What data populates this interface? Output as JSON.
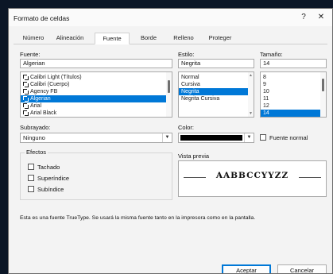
{
  "dialog": {
    "title": "Formato de celdas",
    "help": "?",
    "close": "✕"
  },
  "tabs": [
    {
      "label": "Número"
    },
    {
      "label": "Alineación"
    },
    {
      "label": "Fuente"
    },
    {
      "label": "Borde"
    },
    {
      "label": "Relleno"
    },
    {
      "label": "Proteger"
    }
  ],
  "fuente": {
    "label": "Fuente:",
    "value": "Algerian",
    "list": [
      {
        "name": "Calibri Light (Títulos)"
      },
      {
        "name": "Calibri (Cuerpo)"
      },
      {
        "name": "Agency FB"
      },
      {
        "name": "Algerian"
      },
      {
        "name": "Arial"
      },
      {
        "name": "Arial Black"
      }
    ]
  },
  "estilo": {
    "label": "Estilo:",
    "value": "Negrita",
    "list": [
      "Normal",
      "Cursiva",
      "Negrita",
      "Negrita Cursiva"
    ]
  },
  "tamano": {
    "label": "Tamaño:",
    "value": "14",
    "list": [
      "8",
      "9",
      "10",
      "11",
      "12",
      "14"
    ]
  },
  "subrayado": {
    "label": "Subrayado:",
    "value": "Ninguno"
  },
  "color": {
    "label": "Color:",
    "swatch": "#000000",
    "normal_label": "Fuente normal"
  },
  "efectos": {
    "label": "Efectos",
    "tachado": "Tachado",
    "superindice": "Superíndice",
    "subindice": "Subíndice"
  },
  "vista": {
    "label": "Vista previa",
    "text": "AABBCCYYZZ"
  },
  "info": "Esta es una fuente TrueType. Se usará la misma fuente tanto en la impresora como en la pantalla.",
  "buttons": {
    "ok": "Aceptar",
    "cancel": "Cancelar"
  },
  "colors": {
    "selection": "#0078d7"
  }
}
